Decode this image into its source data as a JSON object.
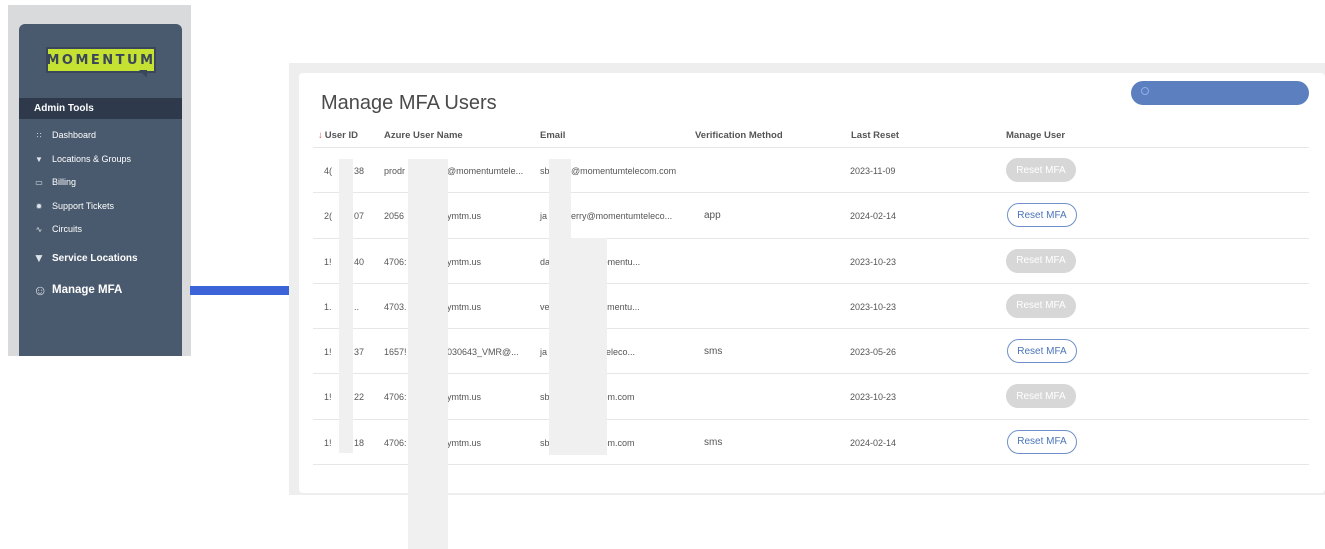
{
  "sidebar": {
    "logo_text": "MOMENTUM",
    "section_title": "Admin Tools",
    "items": [
      {
        "label": "Dashboard",
        "icon": "grid-icon"
      },
      {
        "label": "Locations & Groups",
        "icon": "map-pin-icon"
      },
      {
        "label": "Billing",
        "icon": "credit-card-icon"
      },
      {
        "label": "Support Tickets",
        "icon": "bug-icon"
      },
      {
        "label": "Circuits",
        "icon": "pulse-icon"
      },
      {
        "label": "Service Locations",
        "icon": "map-pin-icon"
      },
      {
        "label": "Manage MFA",
        "icon": "user-gear-icon"
      }
    ]
  },
  "main": {
    "title": "Manage MFA Users",
    "columns": [
      "User ID",
      "Azure User Name",
      "Email",
      "Verification Method",
      "Last Reset",
      "Manage User"
    ],
    "sort_indicator": "↓",
    "rows": [
      {
        "user_id_a": "4(",
        "user_id_b": "38",
        "azure_a": "prodr",
        "azure_b": "@momentumtele...",
        "email_a": "sb",
        "email_b": "@momentumtelecom.com",
        "method": "",
        "last_reset": "2023-11-09",
        "action": "Reset MFA",
        "enabled": false
      },
      {
        "user_id_a": "2(",
        "user_id_b": "07",
        "azure_a": "2056",
        "azure_b": "ymtm.us",
        "email_a": "ja",
        "email_b": "erry@momentumteleco...",
        "method": "app",
        "last_reset": "2024-02-14",
        "action": "Reset MFA",
        "enabled": true
      },
      {
        "user_id_a": "1!",
        "user_id_b": "40",
        "azure_a": "4706:",
        "azure_b": "ymtm.us",
        "email_a": "da",
        "email_b": "ri@gomomentu...",
        "method": "",
        "last_reset": "2023-10-23",
        "action": "Reset MFA",
        "enabled": false
      },
      {
        "user_id_a": "1.",
        "user_id_b": "..",
        "azure_a": "4703.",
        "azure_b": "ymtm.us",
        "email_a": "ve",
        "email_b": "etty@momentu...",
        "method": "",
        "last_reset": "2023-10-23",
        "action": "Reset MFA",
        "enabled": false
      },
      {
        "user_id_a": "1!",
        "user_id_b": "37",
        "azure_a": "1657!",
        "azure_b": "030643_VMR@...",
        "email_a": "ja",
        "email_b": "mentumteleco...",
        "method": "sms",
        "last_reset": "2023-05-26",
        "action": "Reset MFA",
        "enabled": true
      },
      {
        "user_id_a": "1!",
        "user_id_b": "22",
        "azure_a": "4706:",
        "azure_b": "ymtm.us",
        "email_a": "sb",
        "email_b": "umtelecom.com",
        "method": "",
        "last_reset": "2023-10-23",
        "action": "Reset MFA",
        "enabled": false
      },
      {
        "user_id_a": "1!",
        "user_id_b": "18",
        "azure_a": "4706:",
        "azure_b": "ymtm.us",
        "email_a": "sb",
        "email_b": "umtelecom.com",
        "method": "sms",
        "last_reset": "2024-02-14",
        "action": "Reset MFA",
        "enabled": true
      }
    ]
  },
  "colors": {
    "sidebar_bg": "#4a5a6e",
    "logo_bg": "#c5e233",
    "arrow": "#3d63d9",
    "search_pill": "#5b7fbf",
    "button_enabled_border": "#6f90c8",
    "button_disabled_bg": "#d7d7d7"
  }
}
